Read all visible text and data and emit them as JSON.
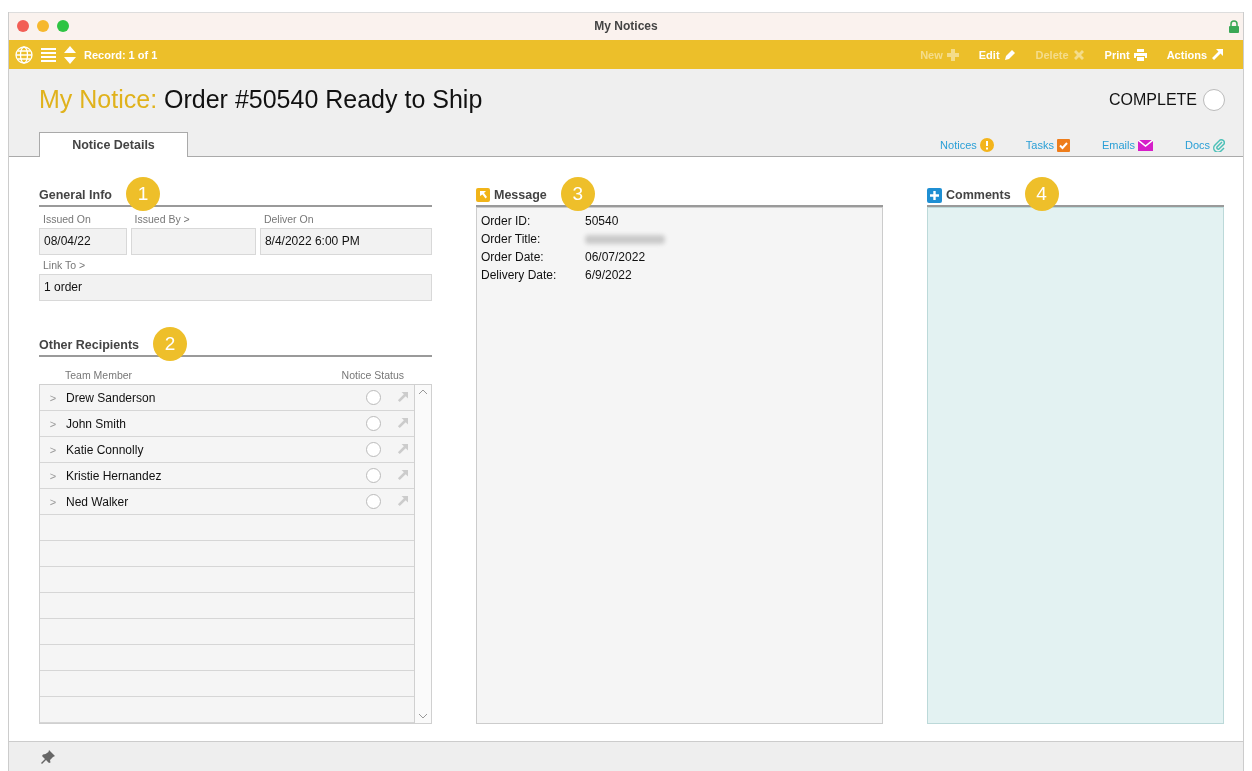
{
  "window": {
    "title": "My Notices"
  },
  "toolbar": {
    "record": "Record: 1 of 1",
    "actions": [
      {
        "label": "New",
        "kind": "new",
        "disabled": true
      },
      {
        "label": "Edit",
        "kind": "edit",
        "disabled": false
      },
      {
        "label": "Delete",
        "kind": "delete",
        "disabled": true
      },
      {
        "label": "Print",
        "kind": "print",
        "disabled": false
      },
      {
        "label": "Actions",
        "kind": "actions",
        "disabled": false
      }
    ]
  },
  "header": {
    "prefix": "My Notice:",
    "title": "Order #50540 Ready to Ship",
    "complete": {
      "label": "COMPLETE",
      "checked": false
    }
  },
  "tabs": [
    {
      "label": "Notice Details",
      "selected": true
    }
  ],
  "links": [
    {
      "label": "Notices",
      "kind": "notices"
    },
    {
      "label": "Tasks",
      "kind": "tasks"
    },
    {
      "label": "Emails",
      "kind": "emails"
    },
    {
      "label": "Docs",
      "kind": "docs"
    }
  ],
  "general_info": {
    "heading": "General Info",
    "badge": "1",
    "fields": [
      {
        "label": "Issued On",
        "value": "08/04/22"
      },
      {
        "label": "Issued By >"
      },
      {
        "label": "Deliver On",
        "value": "8/4/2022 6:00 PM"
      },
      {
        "label": "Link To >",
        "value": "1 order"
      }
    ]
  },
  "recipients": {
    "heading": "Other Recipients",
    "badge": "2",
    "columns": [
      "Team Member",
      "Notice Status"
    ],
    "rows": [
      {
        "expander": ">",
        "name": "Drew Sanderson",
        "checked": false
      },
      {
        "expander": ">",
        "name": "John Smith",
        "checked": false
      },
      {
        "expander": ">",
        "name": "Katie Connolly",
        "checked": false
      },
      {
        "expander": ">",
        "name": "Kristie Hernandez",
        "checked": false
      },
      {
        "expander": ">",
        "name": "Ned Walker",
        "checked": false
      }
    ]
  },
  "message": {
    "heading": "Message",
    "badge": "3",
    "lines": [
      {
        "label": "Order ID:",
        "value": "50540"
      },
      {
        "label": "Order Title:",
        "redacted": true
      },
      {
        "label": "Order Date:",
        "value": "06/07/2022"
      },
      {
        "label": "Delivery Date:",
        "value": "6/9/2022"
      }
    ]
  },
  "comments": {
    "heading": "Comments",
    "badge": "4"
  }
}
